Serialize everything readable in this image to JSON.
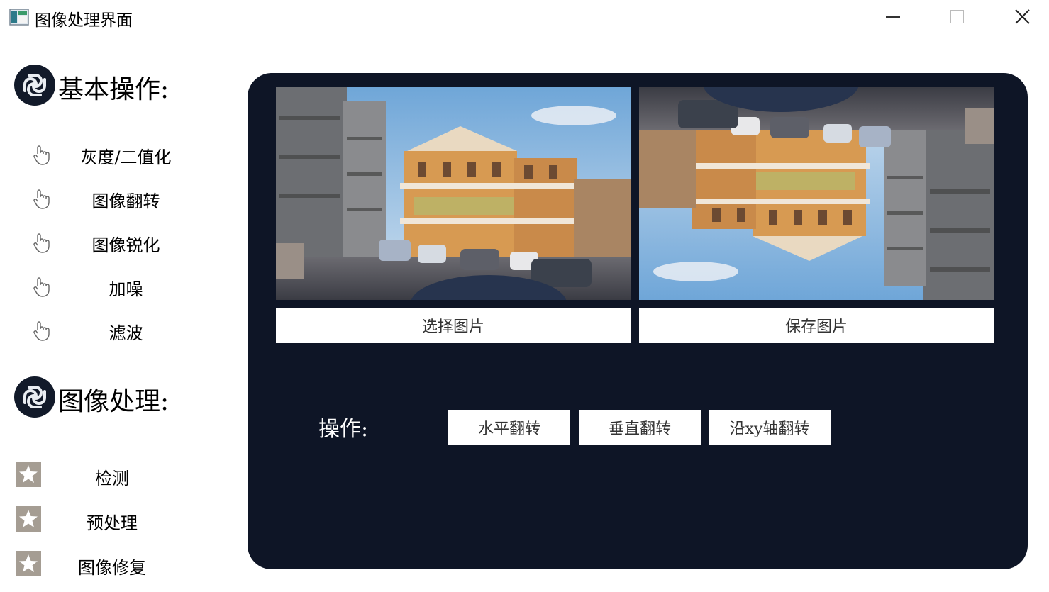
{
  "window": {
    "title": "图像处理界面"
  },
  "sidebar": {
    "basic_section": {
      "title": "基本操作:",
      "items": [
        {
          "label": "灰度/二值化",
          "icon": "hand-pointer-icon"
        },
        {
          "label": "图像翻转",
          "icon": "hand-pointer-icon"
        },
        {
          "label": "图像锐化",
          "icon": "hand-pointer-icon"
        },
        {
          "label": "加噪",
          "icon": "hand-pointer-icon"
        },
        {
          "label": "滤波",
          "icon": "hand-pointer-icon"
        }
      ]
    },
    "processing_section": {
      "title": "图像处理:",
      "items": [
        {
          "label": "检测",
          "icon": "star-icon"
        },
        {
          "label": "预处理",
          "icon": "star-icon"
        },
        {
          "label": "图像修复",
          "icon": "star-icon"
        }
      ]
    }
  },
  "main": {
    "select_image_label": "选择图片",
    "save_image_label": "保存图片",
    "operation_label": "操作:",
    "operations": [
      {
        "label": "水平翻转"
      },
      {
        "label": "垂直翻转"
      },
      {
        "label": "沿xy轴翻转"
      }
    ]
  },
  "colors": {
    "panel_bg": "#0e1526",
    "star_icon": "#a59d93",
    "logo_bg": "#121a2a"
  }
}
